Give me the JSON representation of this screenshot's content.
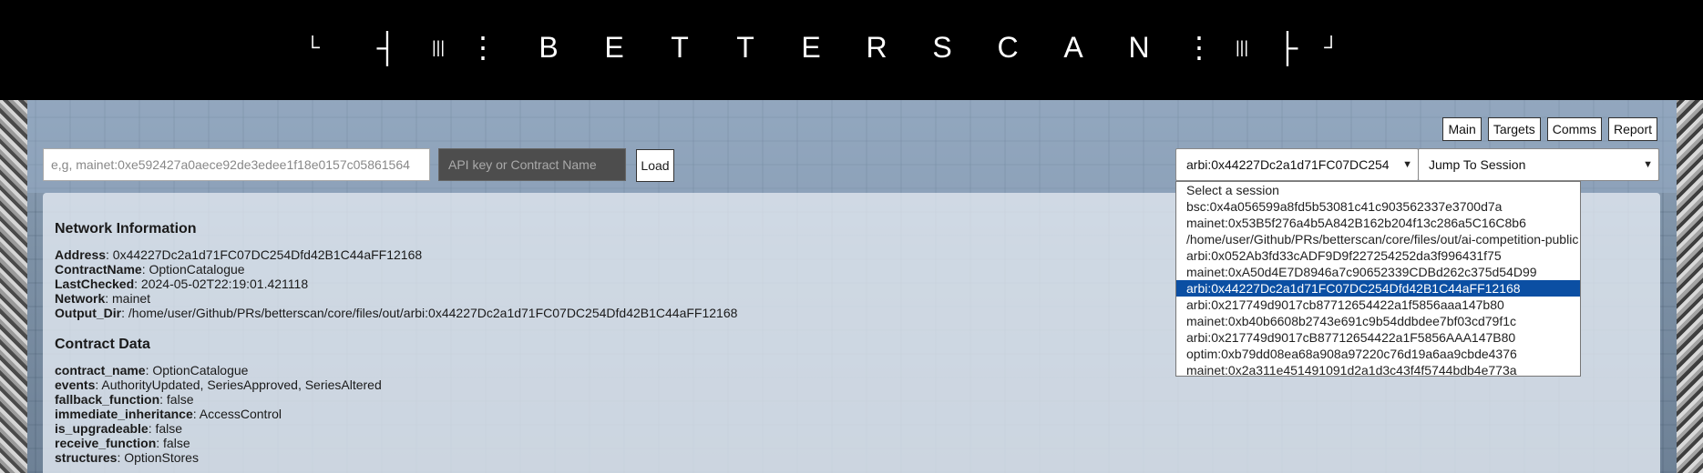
{
  "logo": {
    "glyphs": [
      "└",
      "┤",
      "|||",
      "⋮",
      "B",
      "E",
      "T",
      "T",
      "E",
      "R",
      "S",
      "C",
      "A",
      "N",
      "⋮",
      "|||",
      "├",
      "┘"
    ]
  },
  "nav": {
    "main": "Main",
    "targets": "Targets",
    "comms": "Comms",
    "report": "Report"
  },
  "load_form": {
    "address_placeholder": "e,g, mainet:0xe592427a0aece92de3edee1f18e0157c05861564",
    "api_placeholder": "API key or Contract Name",
    "load_label": "Load"
  },
  "session_select": {
    "value": "arbi:0x44227Dc2a1d71FC07DC254",
    "options": [
      "Select a session",
      "bsc:0x4a056599a8fd5b53081c41c903562337e3700d7a",
      "mainet:0x53B5f276a4b5A842B162b204f13c286a5C16C8b6",
      "/home/user/Github/PRs/betterscan/core/files/out/ai-competition-public",
      "arbi:0x052Ab3fd33cADF9D9f227254252da3f996431f75",
      "mainet:0xA50d4E7D8946a7c90652339CDBd262c375d54D99",
      "arbi:0x44227Dc2a1d71FC07DC254Dfd42B1C44aFF12168",
      "arbi:0x217749d9017cb87712654422a1f5856aaa147b80",
      "mainet:0xb40b6608b2743e691c9b54ddbdee7bf03cd79f1c",
      "arbi:0x217749d9017cB87712654422a1F5856AAA147B80",
      "optim:0xb79dd08ea68a908a97220c76d19a6aa9cbde4376",
      "mainet:0x2a311e451491091d2a1d3c43f4f5744bdb4e773a"
    ],
    "selected_index": 6
  },
  "jump_select": {
    "value": "Jump To Session"
  },
  "network_info": {
    "title": "Network Information",
    "fields": [
      {
        "key": "Address",
        "value": ": 0x44227Dc2a1d71FC07DC254Dfd42B1C44aFF12168"
      },
      {
        "key": "ContractName",
        "value": ": OptionCatalogue"
      },
      {
        "key": "LastChecked",
        "value": ": 2024-05-02T22:19:01.421118"
      },
      {
        "key": "Network",
        "value": ": mainet"
      },
      {
        "key": "Output_Dir",
        "value": ": /home/user/Github/PRs/betterscan/core/files/out/arbi:0x44227Dc2a1d71FC07DC254Dfd42B1C44aFF12168"
      }
    ]
  },
  "contract_data": {
    "title": "Contract Data",
    "fields": [
      {
        "key": "contract_name",
        "value": ": OptionCatalogue"
      },
      {
        "key": "events",
        "value": ": AuthorityUpdated, SeriesApproved, SeriesAltered"
      },
      {
        "key": "fallback_function",
        "value": ": false"
      },
      {
        "key": "immediate_inheritance",
        "value": ": AccessControl"
      },
      {
        "key": "is_upgradeable",
        "value": ": false"
      },
      {
        "key": "receive_function",
        "value": ": false"
      },
      {
        "key": "structures",
        "value": ": OptionStores"
      }
    ]
  }
}
